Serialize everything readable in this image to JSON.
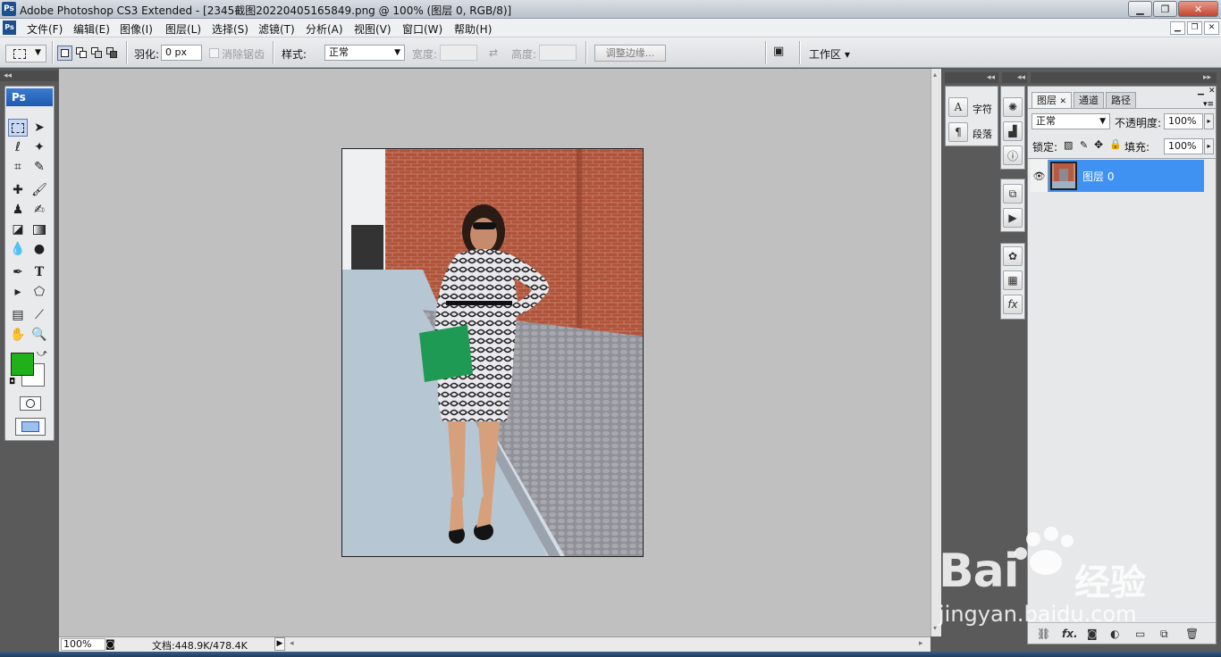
{
  "window": {
    "app_icon": "Ps",
    "title": "Adobe Photoshop CS3 Extended - [2345截图20220405165849.png @ 100% (图层 0, RGB/8)]"
  },
  "menu": [
    "文件(F)",
    "编辑(E)",
    "图像(I)",
    "图层(L)",
    "选择(S)",
    "滤镜(T)",
    "分析(A)",
    "视图(V)",
    "窗口(W)",
    "帮助(H)"
  ],
  "options": {
    "feather_label": "羽化:",
    "feather_value": "0 px",
    "antialias_label": "消除锯齿",
    "style_label": "样式:",
    "style_value": "正常",
    "width_label": "宽度:",
    "height_label": "高度:",
    "refine_edge": "调整边缘...",
    "workspace": "工作区 ▾"
  },
  "toolbox": {
    "badge": "Ps",
    "foreground_color": "#1fb01a",
    "background_color": "#ffffff"
  },
  "status": {
    "zoom": "100%",
    "doc_info": "文档:448.9K/478.4K"
  },
  "panels": {
    "character_label": "字符",
    "paragraph_label": "段落",
    "tabs": [
      "图层",
      "通道",
      "路径"
    ],
    "blend_mode": "正常",
    "opacity_label": "不透明度:",
    "opacity_value": "100%",
    "lock_label": "锁定:",
    "fill_label": "填充:",
    "fill_value": "100%",
    "layer_name": "图层 0"
  },
  "watermark": {
    "line1": "Bai",
    "line1b": "经验",
    "line2": "jingyan.baidu.com"
  }
}
